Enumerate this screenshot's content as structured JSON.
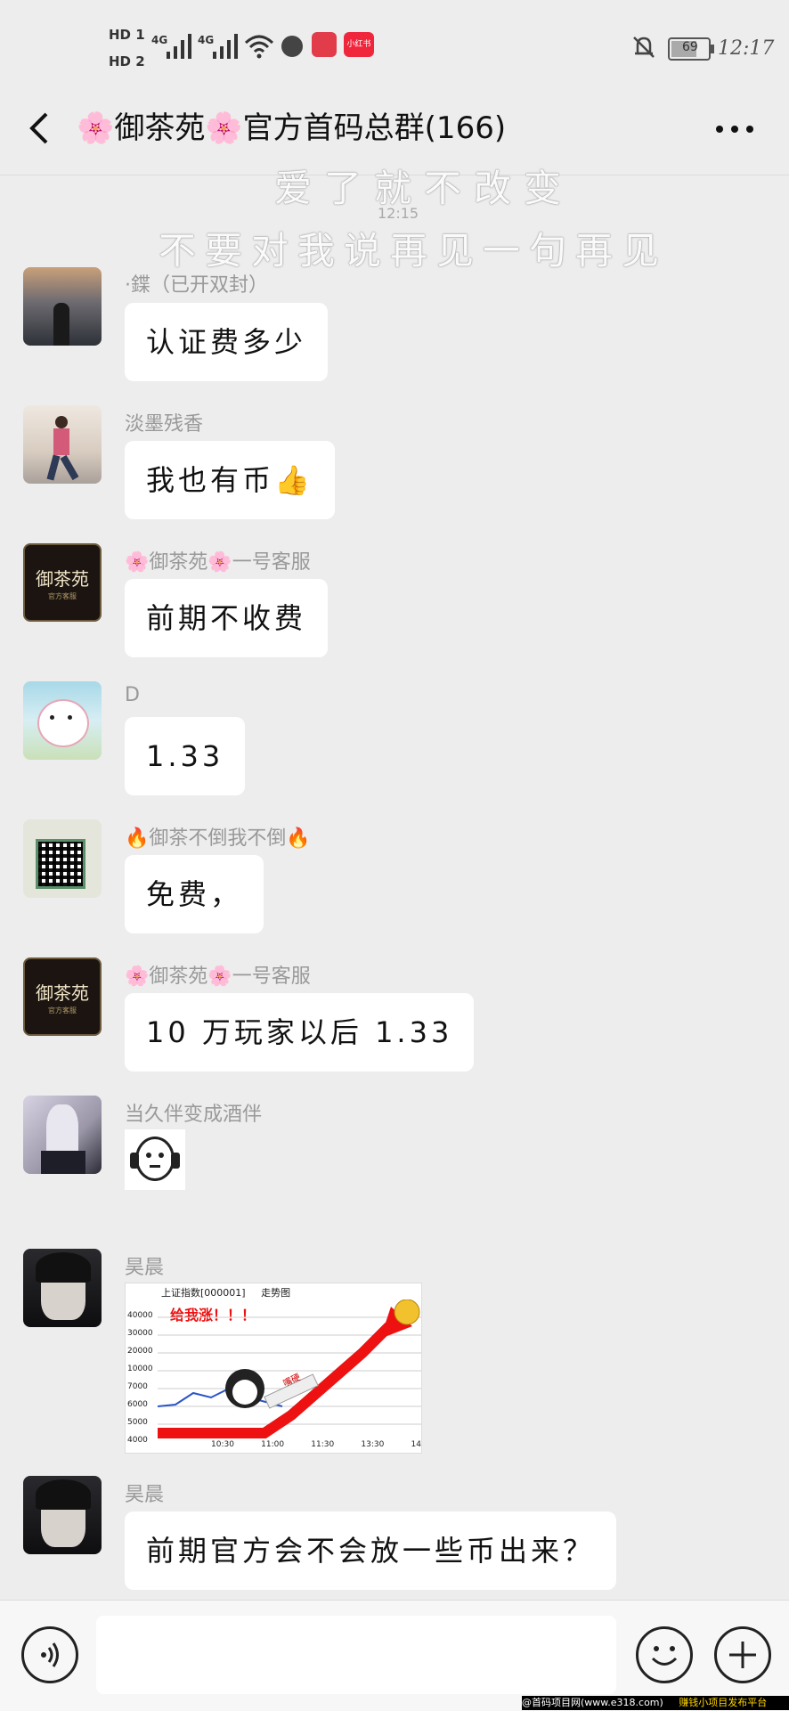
{
  "status": {
    "hd1": "HD 1",
    "hd2": "HD 2",
    "net1": "4G",
    "net2": "4G",
    "app_badge": "小红书",
    "battery": "69",
    "time": "12:17"
  },
  "header": {
    "title": "🌸御茶苑🌸官方首码总群(166)"
  },
  "watermark": {
    "line1": "爱了就不改变",
    "line2": "不要对我说再见一句再见",
    "time": "12:15"
  },
  "messages": [
    {
      "sender": "·鍱（已开双封）",
      "text": "认证费多少",
      "avatar": "avatar-sunset"
    },
    {
      "sender": "淡墨残香",
      "text": "我也有币👍",
      "avatar": "avatar-girl"
    },
    {
      "sender": "🌸御茶苑🌸一号客服",
      "text": "前期不收费",
      "avatar": "avatar-logo"
    },
    {
      "sender": "D",
      "text": "1.33",
      "avatar": "avatar-cartoon"
    },
    {
      "sender": "🔥御茶不倒我不倒🔥",
      "text": "免费，",
      "avatar": "avatar-qr"
    },
    {
      "sender": "🌸御茶苑🌸一号客服",
      "text": "10 万玩家以后 1.33",
      "avatar": "avatar-logo"
    },
    {
      "sender": "当久伴变成酒伴",
      "sticker": "headphone-face-sticker",
      "avatar": "avatar-anime"
    },
    {
      "sender": "昊晨",
      "image": "stock-chart-meme",
      "avatar": "avatar-dark"
    },
    {
      "sender": "昊晨",
      "text": "前期官方会不会放一些币出来？",
      "avatar": "avatar-dark"
    }
  ],
  "avatar_logo_text": "御茶苑",
  "avatar_logo_sub": "官方客服",
  "meme": {
    "title": "上证指数[000001]",
    "title2": "走势图",
    "caption": "给我涨！！！",
    "rocket_label": "嘴硬",
    "yticks": [
      "40000",
      "30000",
      "20000",
      "10000",
      "7000",
      "6000",
      "5000",
      "4000"
    ],
    "xticks": [
      "10:30",
      "11:00",
      "11:30",
      "13:30",
      "14"
    ]
  },
  "footer": {
    "left": "@首码项目网(www.e318.com)",
    "right": "赚钱小项目发布平台"
  },
  "colors": {
    "background": "#ededed",
    "bubble": "#ffffff",
    "sender": "#999999"
  }
}
